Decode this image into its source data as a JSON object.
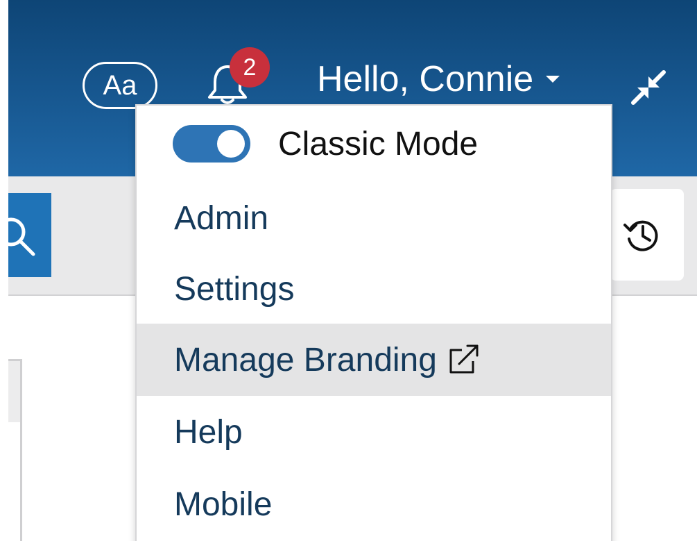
{
  "header": {
    "font_size_label": "Aa",
    "notification_count": "2",
    "greeting": "Hello, Connie",
    "icons": {
      "bell": "bell-icon",
      "caret": "caret-down-icon",
      "collapse": "collapse-arrows-icon"
    }
  },
  "toolbar": {
    "icons": {
      "search": "search-icon",
      "history": "history-icon"
    }
  },
  "user_menu": {
    "classic_mode": {
      "label": "Classic Mode",
      "enabled": true
    },
    "items": [
      {
        "label": "Admin"
      },
      {
        "label": "Settings"
      },
      {
        "label": "Manage Branding",
        "external": true,
        "highlighted": true
      },
      {
        "label": "Help"
      },
      {
        "label": "Mobile"
      }
    ]
  },
  "colors": {
    "header_top": "#0e4576",
    "header_bottom": "#1f67a6",
    "badge": "#c8303c",
    "toggle": "#2e74b5",
    "menu_text": "#153a5b",
    "highlight_bg": "#e4e4e5",
    "search_button": "#1f73b7"
  }
}
